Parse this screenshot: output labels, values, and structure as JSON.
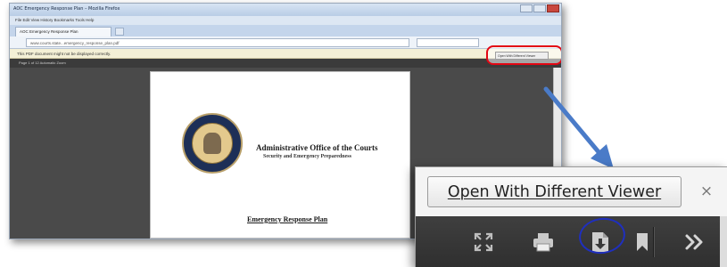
{
  "browser": {
    "window_title": "AOC Emergency Response Plan – Mozilla Firefox",
    "menu": "File  Edit  View  History  Bookmarks  Tools  Help",
    "tab_title": "AOC Emergency Response Plan",
    "url": "www.courts.state...emergency_response_plan.pdf",
    "notification": "This PDF document might not be displayed correctly.",
    "toolbar_text": "Page  1  of 12                 Automatic Zoom"
  },
  "document": {
    "org_name": "Administrative Office of the Courts",
    "department": "Security and Emergency Preparedness",
    "plan_title": "Emergency Response Plan"
  },
  "callout": {
    "open_with_label": "Open With Different Viewer",
    "close_glyph": "×",
    "toolbar_icons": [
      "fullscreen-icon",
      "print-icon",
      "download-icon",
      "bookmark-icon",
      "tools-menu-icon"
    ],
    "highlight_color": "#e30613",
    "circle_color": "#1f2fbf",
    "arrow_color": "#4a7bc8"
  }
}
